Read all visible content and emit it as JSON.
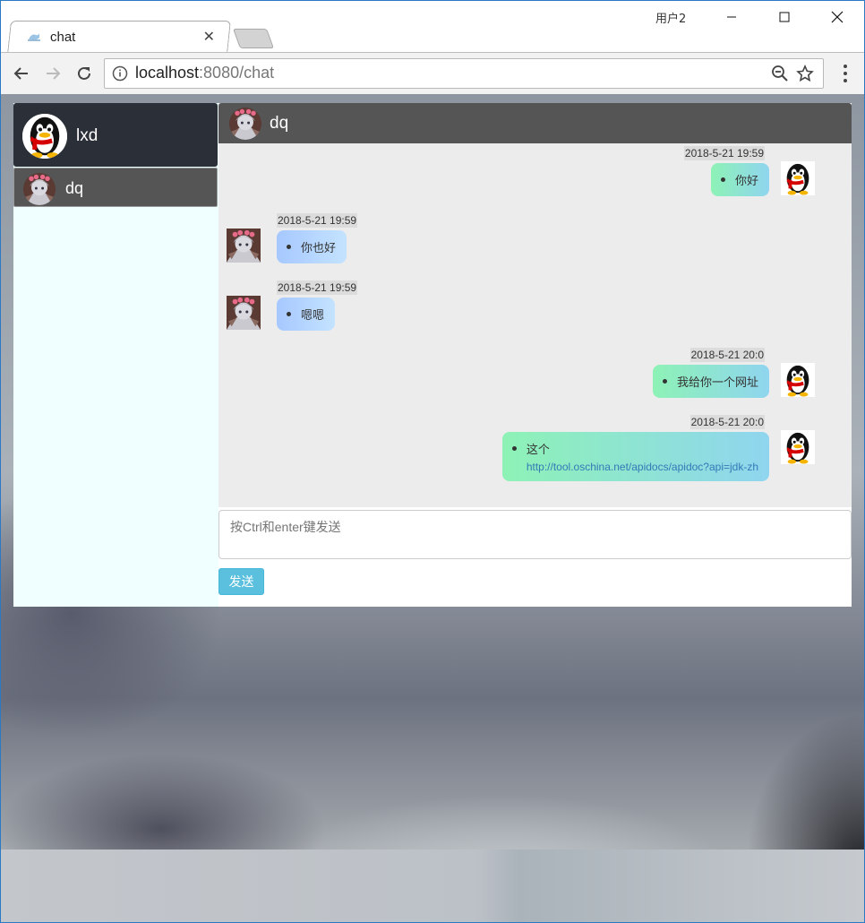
{
  "browser": {
    "tab_title": "chat",
    "profile_label": "用户2",
    "url_host": "localhost",
    "url_rest": ":8080/chat"
  },
  "sidebar": {
    "me": {
      "name": "lxd"
    },
    "contacts": [
      {
        "name": "dq",
        "active": true
      }
    ]
  },
  "chat": {
    "peer_name": "dq",
    "messages": [
      {
        "from": "me",
        "time": "2018-5-21 19:59",
        "text": "你好"
      },
      {
        "from": "peer",
        "time": "2018-5-21 19:59",
        "text": "你也好"
      },
      {
        "from": "peer",
        "time": "2018-5-21 19:59",
        "text": "嗯嗯"
      },
      {
        "from": "me",
        "time": "2018-5-21 20:0",
        "text": "我给你一个网址"
      },
      {
        "from": "me",
        "time": "2018-5-21 20:0",
        "text": "这个",
        "link": "http://tool.oschina.net/apidocs/apidoc?api=jdk-zh"
      }
    ],
    "input_placeholder": "按Ctrl和enter键发送",
    "send_label": "发送"
  },
  "colors": {
    "my_bubble": "#8ef2b6",
    "peer_bubble": "#a6c8ff",
    "send_button": "#5bc0de",
    "header": "#555555",
    "sidebar_me": "#2b2f38",
    "sidebar_bg": "#f0ffff"
  },
  "icons": {
    "my_avatar": "penguin-avatar-icon",
    "peer_avatar": "anime-girl-avatar-icon"
  }
}
